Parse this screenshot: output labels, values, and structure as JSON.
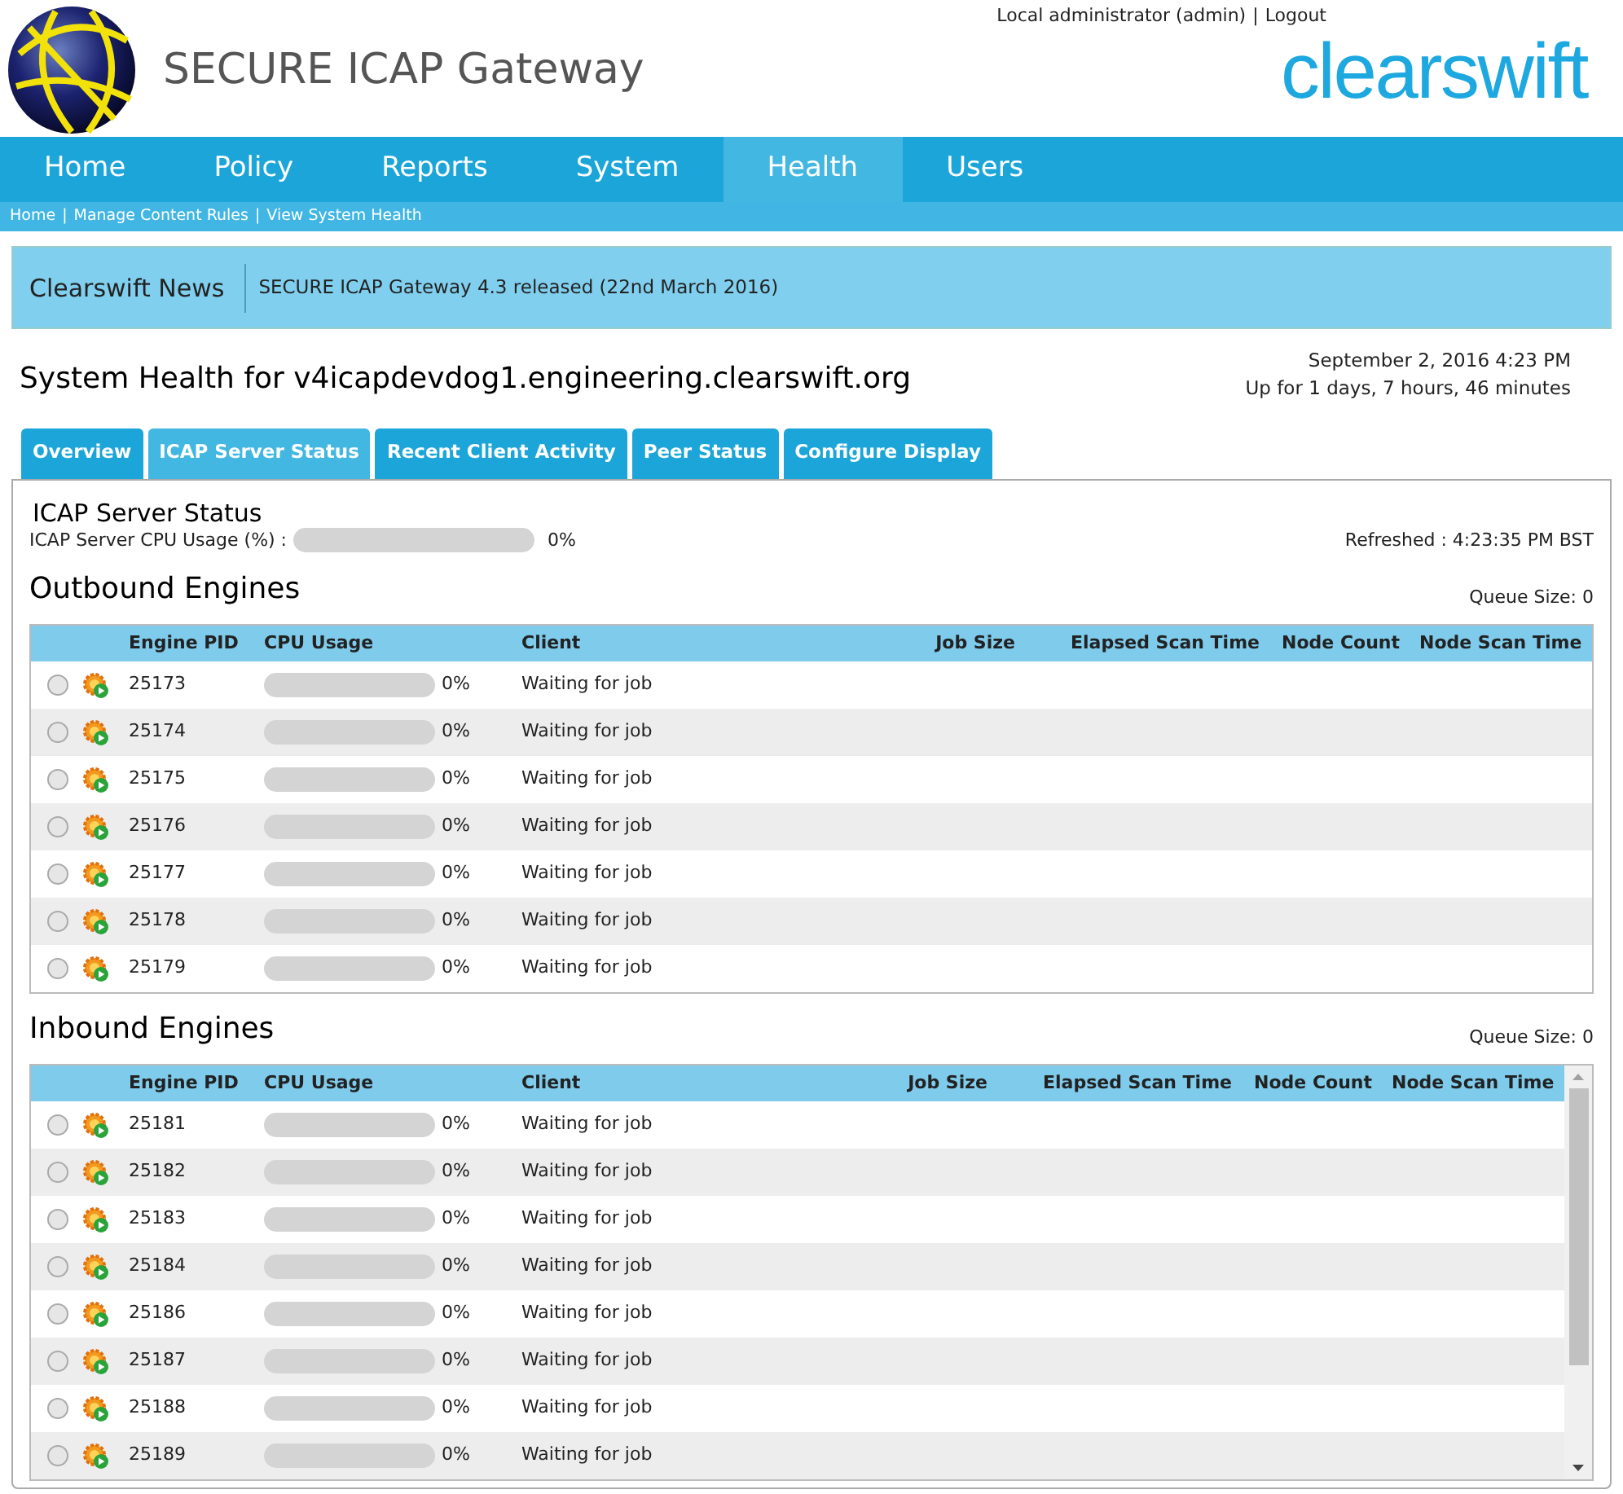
{
  "header": {
    "product": "SECURE ICAP Gateway",
    "user": "Local administrator (admin)",
    "separator": "|",
    "logout": "Logout",
    "brand": "clearswift"
  },
  "nav": [
    {
      "label": "Home",
      "selected": false
    },
    {
      "label": "Policy",
      "selected": false
    },
    {
      "label": "Reports",
      "selected": false
    },
    {
      "label": "System",
      "selected": false
    },
    {
      "label": "Health",
      "selected": true
    },
    {
      "label": "Users",
      "selected": false
    }
  ],
  "breadcrumb": [
    "Home",
    "Manage Content Rules",
    "View System Health"
  ],
  "news": {
    "title": "Clearswift News",
    "text": "SECURE ICAP Gateway 4.3 released (22nd March 2016)"
  },
  "page": {
    "title": "System Health for v4icapdevdog1.engineering.clearswift.org",
    "date": "September 2, 2016 4:23 PM",
    "uptime": "Up for 1 days, 7 hours, 46 minutes"
  },
  "tabs": [
    {
      "label": "Overview",
      "selected": false
    },
    {
      "label": "ICAP Server Status",
      "selected": true
    },
    {
      "label": "Recent Client Activity",
      "selected": false
    },
    {
      "label": "Peer Status",
      "selected": false
    },
    {
      "label": "Configure Display",
      "selected": false
    }
  ],
  "status": {
    "title": "ICAP Server Status",
    "cpu_label": "ICAP Server CPU Usage (%) :",
    "level": 0,
    "cpu_reading": "0%",
    "refreshed": "Refreshed : 4:23:35 PM BST"
  },
  "engines": [
    {
      "title": "Outbound Engines",
      "queue": "Queue Size: 0",
      "scrollbar": false,
      "columns": [
        "Engine PID",
        "CPU Usage",
        "Client",
        "Job Size",
        "Elapsed Scan Time",
        "Node Count",
        "Node Scan Time"
      ],
      "rows": [
        {
          "selected": false,
          "pid": "25173",
          "level": 0,
          "cpu": "0%",
          "client": "Waiting for job"
        },
        {
          "selected": false,
          "pid": "25174",
          "level": 0,
          "cpu": "0%",
          "client": "Waiting for job"
        },
        {
          "selected": false,
          "pid": "25175",
          "level": 0,
          "cpu": "0%",
          "client": "Waiting for job"
        },
        {
          "selected": false,
          "pid": "25176",
          "level": 0,
          "cpu": "0%",
          "client": "Waiting for job"
        },
        {
          "selected": false,
          "pid": "25177",
          "level": 0,
          "cpu": "0%",
          "client": "Waiting for job"
        },
        {
          "selected": false,
          "pid": "25178",
          "level": 0,
          "cpu": "0%",
          "client": "Waiting for job"
        },
        {
          "selected": false,
          "pid": "25179",
          "level": 0,
          "cpu": "0%",
          "client": "Waiting for job"
        }
      ]
    },
    {
      "title": "Inbound Engines",
      "queue": "Queue Size: 0",
      "scrollbar": true,
      "columns": [
        "Engine PID",
        "CPU Usage",
        "Client",
        "Job Size",
        "Elapsed Scan Time",
        "Node Count",
        "Node Scan Time"
      ],
      "rows": [
        {
          "selected": false,
          "pid": "25181",
          "level": 0,
          "cpu": "0%",
          "client": "Waiting for job"
        },
        {
          "selected": false,
          "pid": "25182",
          "level": 0,
          "cpu": "0%",
          "client": "Waiting for job"
        },
        {
          "selected": false,
          "pid": "25183",
          "level": 0,
          "cpu": "0%",
          "client": "Waiting for job"
        },
        {
          "selected": false,
          "pid": "25184",
          "level": 0,
          "cpu": "0%",
          "client": "Waiting for job"
        },
        {
          "selected": false,
          "pid": "25186",
          "level": 0,
          "cpu": "0%",
          "client": "Waiting for job"
        },
        {
          "selected": false,
          "pid": "25187",
          "level": 0,
          "cpu": "0%",
          "client": "Waiting for job"
        },
        {
          "selected": false,
          "pid": "25188",
          "level": 0,
          "cpu": "0%",
          "client": "Waiting for job"
        },
        {
          "selected": false,
          "pid": "25189",
          "level": 0,
          "cpu": "0%",
          "client": "Waiting for job"
        }
      ]
    }
  ]
}
